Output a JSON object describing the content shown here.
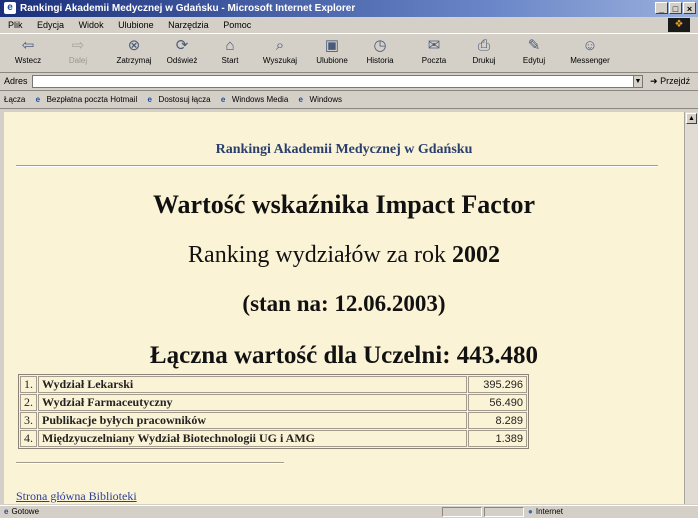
{
  "window": {
    "title": "Rankingi Akademii Medycznej w Gdańsku - Microsoft Internet Explorer"
  },
  "menu": [
    "Plik",
    "Edycja",
    "Widok",
    "Ulubione",
    "Narzędzia",
    "Pomoc"
  ],
  "toolbar": {
    "back": "Wstecz",
    "forward": "Dalej",
    "stop": "Zatrzymaj",
    "refresh": "Odśwież",
    "home": "Start",
    "search": "Wyszukaj",
    "favorites": "Ulubione",
    "history": "Historia",
    "mail": "Poczta",
    "print": "Drukuj",
    "edit": "Edytuj",
    "messenger": "Messenger"
  },
  "address": {
    "label": "Adres",
    "value": "",
    "go": "Przejdź"
  },
  "links": {
    "label": "Łącza",
    "items": [
      "Bezpłatna poczta Hotmail",
      "Dostosuj łącza",
      "Windows Media",
      "Windows"
    ]
  },
  "page": {
    "header": "Rankingi Akademii Medycznej w Gdańsku",
    "impact_title": "Wartość wskaźnika Impact Factor",
    "ranking_prefix": "Ranking wydziałów za rok",
    "ranking_year": "2002",
    "state": "(stan na: 12.06.2003)",
    "total": "Łączna wartość dla Uczelni: 443.480",
    "rows": [
      {
        "n": "1.",
        "name": "Wydział Lekarski",
        "value": "395.296"
      },
      {
        "n": "2.",
        "name": "Wydział Farmaceutyczny",
        "value": "56.490"
      },
      {
        "n": "3.",
        "name": "Publikacje byłych pracowników",
        "value": "8.289"
      },
      {
        "n": "4.",
        "name": "Międzyuczelniany Wydział Biotechnologii UG i AMG",
        "value": "1.389"
      }
    ],
    "footer_link": "Strona główna Biblioteki"
  },
  "status": {
    "text": "Gotowe",
    "zone": "Internet"
  },
  "colors": {
    "page_bg": "#fbf3d6",
    "header_text": "#2a3f6e",
    "link": "#2a3f9a"
  }
}
